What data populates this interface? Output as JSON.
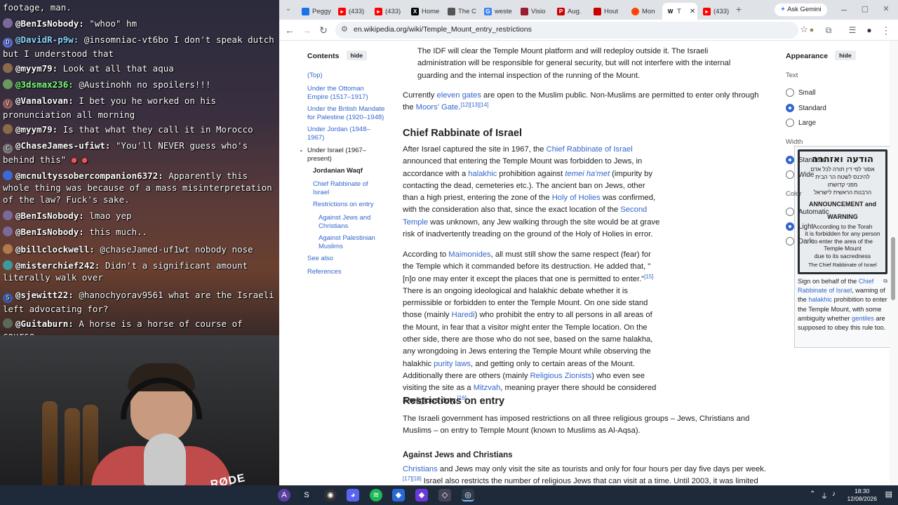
{
  "chat": {
    "messages": [
      {
        "user": "",
        "text": "footage, man.",
        "color": "#ffffff",
        "avatar": ""
      },
      {
        "user": "@BenIsNobody:",
        "text": "\"whoo\" hm",
        "color": "#ffffff",
        "avatar": "#7a6a9a"
      },
      {
        "user": "@DavidR-p9w:",
        "text": "@insomniac-vt6bo I don't speak dutch but I understood that",
        "color": "#8ad7ff",
        "avatar": "#5b6bd6"
      },
      {
        "user": "@myym79:",
        "text": "Look at all that aqua",
        "color": "#ffffff",
        "avatar": "#8a6a4a"
      },
      {
        "user": "@3dsmax236:",
        "text": "@Austinohh no spoilers!!!",
        "color": "#7dff7d",
        "avatar": "#6a9a5a"
      },
      {
        "user": "@Vanalovan:",
        "text": "I bet you he worked on his pronunciation all morning",
        "color": "#ffffff",
        "avatar": "#9a5a5a"
      },
      {
        "user": "@myym79:",
        "text": "Is that what they call it in Morocco",
        "color": "#ffffff",
        "avatar": "#8a6a4a"
      },
      {
        "user": "@ChaseJames-ufiwt:",
        "text": "\"You'll NEVER guess who's behind this\"",
        "color": "#ffffff",
        "avatar": "#7a7a7a"
      },
      {
        "user": "@mcnultyssobercompanion6372:",
        "text": "Apparently this whole thing was because of a mass misinterpretation of the law? Fuck's sake.",
        "color": "#ffffff",
        "avatar": "#3a6ad6"
      },
      {
        "user": "@BenIsNobody:",
        "text": "lmao yep",
        "color": "#ffffff",
        "avatar": "#7a6a9a"
      },
      {
        "user": "@BenIsNobody:",
        "text": "this much..",
        "color": "#ffffff",
        "avatar": "#7a6a9a"
      },
      {
        "user": "@billclockwell:",
        "text": "@chaseJamed-uf1wt nobody nose",
        "color": "#ffffff",
        "avatar": "#b07a4a"
      },
      {
        "user": "@misterchief242:",
        "text": "Didn't a significant amount literally walk over",
        "color": "#ffffff",
        "avatar": "#3a9aa0"
      },
      {
        "user": "@sjewitt22:",
        "text": "@hanochyorav9561 what are the Israeli left advocating for?",
        "color": "#ffffff",
        "avatar": "#3a5ab0"
      },
      {
        "user": "@Guitaburn:",
        "text": "A horse is a horse of course of course",
        "color": "#ffffff",
        "avatar": "#5a6a5a"
      }
    ],
    "avatar_letters": [
      "",
      "",
      "D",
      "",
      "",
      "V",
      "",
      "C",
      "",
      "",
      "",
      "",
      "",
      "S",
      ""
    ]
  },
  "webcam": {
    "mic_brand": "RØDE"
  },
  "browser": {
    "tabs": [
      {
        "label": "Peggy",
        "color": "#1a73e8"
      },
      {
        "label": "(433)",
        "color": "#ff0000"
      },
      {
        "label": "(433)",
        "color": "#ff0000"
      },
      {
        "label": "Home",
        "color": "#000000"
      },
      {
        "label": "The C",
        "color": "#555555"
      },
      {
        "label": "weste",
        "color": "#4285f4"
      },
      {
        "label": "Visio",
        "color": "#9b1b30"
      },
      {
        "label": "Aug.",
        "color": "#cc0000"
      },
      {
        "label": "Hout",
        "color": "#cc0000"
      },
      {
        "label": "Mon",
        "color": "#ff4500"
      },
      {
        "label": "T",
        "color": "#000000"
      },
      {
        "label": "(433)",
        "color": "#ff0000"
      }
    ],
    "ask_gemini": "Ask Gemini",
    "url": "en.wikipedia.org/wiki/Temple_Mount_entry_restrictions"
  },
  "toc": {
    "title": "Contents",
    "hide": "hide",
    "items": [
      "(Top)",
      "Under the Ottoman Empire (1517–1917)",
      "Under the British Mandate for Palestine (1920–1948)",
      "Under Jordan (1948–1967)",
      "Under Israel (1967–present)",
      "Jordanian Waqf",
      "Chief Rabbinate of Israel",
      "Restrictions on entry",
      "Against Jews and Christians",
      "Against Palestinian Muslims",
      "See also",
      "References"
    ]
  },
  "article": {
    "quote": "The IDF will clear the Temple Mount platform and will redeploy outside it. The Israeli administration will be responsible for general security, but will not interfere with the internal guarding and the internal inspection of the running of the Mount.",
    "p_gates_a": "Currently ",
    "p_gates_link": "eleven gates",
    "p_gates_b": " are open to the Muslim public. Non-Muslims are permitted to enter only through the ",
    "p_gates_link2": "Moors' Gate",
    "p_gates_refs": "[12][13][14]",
    "h_rabbinate": "Chief Rabbinate of Israel",
    "p1_a": "After Israel captured the site in 1967, the ",
    "p1_l1": "Chief Rabbinate of Israel",
    "p1_b": " announced that entering the Temple Mount was forbidden to Jews, in accordance with a ",
    "p1_l2": "halakhic",
    "p1_c": " prohibition against ",
    "p1_l3": "temei ha'met",
    "p1_d": " (impurity by contacting the dead, cemeteries etc.). The ancient ban on Jews, other than a high priest, entering the zone of the ",
    "p1_l4": "Holy of Holies",
    "p1_e": " was confirmed, with the consideration also that, since the exact location of the ",
    "p1_l5": "Second Temple",
    "p1_f": " was unknown, any Jew walking through the site would be at grave risk of inadvertently treading on the ground of the Holy of Holies in error.",
    "p2_a": "According to ",
    "p2_l1": "Maimonides",
    "p2_b": ", all must still show the same respect (fear) for the Temple which it commanded before its destruction. He added that, \"[n]o one may enter it except the places that one is permitted to enter.\"",
    "p2_r1": "[15]",
    "p2_c": " There is an ongoing ideological and halakhic debate whether it is permissible or forbidden to enter the Temple Mount. On one side stand those (mainly ",
    "p2_l2": "Haredi",
    "p2_d": ") who prohibit the entry to all persons in all areas of the Mount, in fear that a visitor might enter the Temple location. On the other side, there are those who do not see, based on the same halakha, any wrongdoing in Jews entering the Temple Mount while observing the halakhic ",
    "p2_l3": "purity laws",
    "p2_e": ", and getting only to certain areas of the Mount. Additionally there are others (mainly ",
    "p2_l4": "Religious Zionists",
    "p2_f": ") who even see visiting the site as a ",
    "p2_l5": "Mitzvah",
    "p2_g": ", meaning prayer there should be considered a religious duty.",
    "p2_r2": "[16]",
    "h_restrictions": "Restrictions on entry",
    "p3": "The Israeli government has imposed restrictions on all three religious groups – Jews, Christians and Muslims – on entry to Temple Mount (known to Muslims as Al-Aqsa).",
    "h_against": "Against Jews and Christians",
    "p4_l1": "Christians",
    "p4_a": " and Jews may only visit the site as tourists and only for four hours per day five days per week.",
    "p4_r": "[17][18]",
    "p4_b": " Israel also restricts the number of religious Jews that can visit at a time. Until 2003, it was limited"
  },
  "figure": {
    "sign_he_title": "הודעה ואזהרה",
    "sign_he_1": "אסור לפי דין תורה לכל אדם",
    "sign_he_2": "להיכנס לשטח הר הבית",
    "sign_he_3": "מפני קדושתו",
    "sign_he_4": "הרבנות הראשית לישראל",
    "sign_en_title": "ANNOUNCEMENT and WARNING",
    "sign_en_lines": [
      "According to the Torah",
      "it is forbidden for any person",
      "to enter the area of the",
      "Temple Mount",
      "due to its sacredness"
    ],
    "sign_en_sig": "The Chief Rabbinate of Israel",
    "cap_a": "Sign on behalf of the ",
    "cap_l1": "Chief Rabbinate of Israel",
    "cap_b": ", warning of the ",
    "cap_l2": "halakhic",
    "cap_c": " prohibition to enter the Temple Mount, with some ambiguity whether ",
    "cap_l3": "gentiles",
    "cap_d": " are supposed to obey this rule too."
  },
  "appearance": {
    "title": "Appearance",
    "hide": "hide",
    "text_label": "Text",
    "text_options": [
      "Small",
      "Standard",
      "Large"
    ],
    "text_selected": 1,
    "width_label": "Width",
    "width_options": [
      "Standard",
      "Wide"
    ],
    "width_selected": 0,
    "color_label": "Color",
    "color_options": [
      "Automatic",
      "Light",
      "Dark"
    ],
    "color_selected": 1
  },
  "taskbar": {
    "time": "18:30",
    "date": "12/08/2026"
  }
}
